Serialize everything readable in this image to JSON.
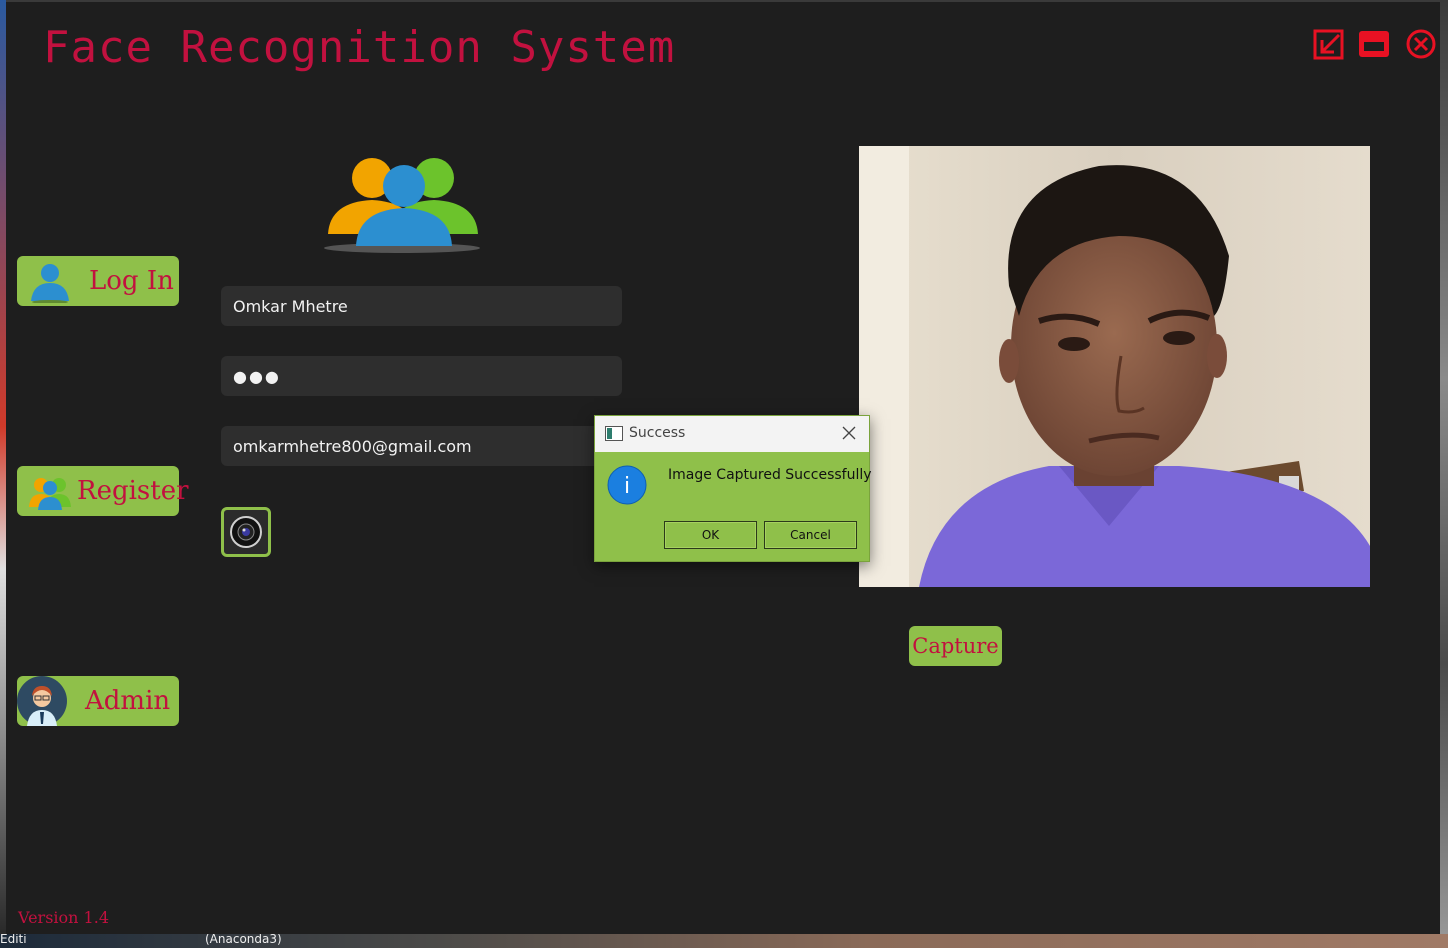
{
  "app": {
    "title": "Face Recognition System",
    "version": "Version 1.4"
  },
  "window_controls": {
    "minimize_icon": "restore-down-icon",
    "maximize_icon": "maximize-icon",
    "close_icon": "close-circle-icon"
  },
  "sidebar": {
    "items": [
      {
        "label": "Log In",
        "icon": "user-icon"
      },
      {
        "label": "Register",
        "icon": "users-icon"
      },
      {
        "label": "Admin",
        "icon": "admin-avatar-icon"
      }
    ]
  },
  "form": {
    "name_value": "Omkar Mhetre",
    "password_value": "●●●",
    "email_value": "omkarmhetre800@gmail.com",
    "camera_button_icon": "camera-icon"
  },
  "capture": {
    "label": "Capture"
  },
  "dialog": {
    "title": "Success",
    "message": "Image Captured Successfully",
    "ok_label": "OK",
    "cancel_label": "Cancel"
  },
  "taskbar": {
    "left_text": "Editi",
    "middle_text": "(Anaconda3)"
  },
  "colors": {
    "background": "#1e1e1e",
    "accent_green": "#8fc04a",
    "accent_red": "#c2113f",
    "field_bg": "#2e2e2e"
  }
}
